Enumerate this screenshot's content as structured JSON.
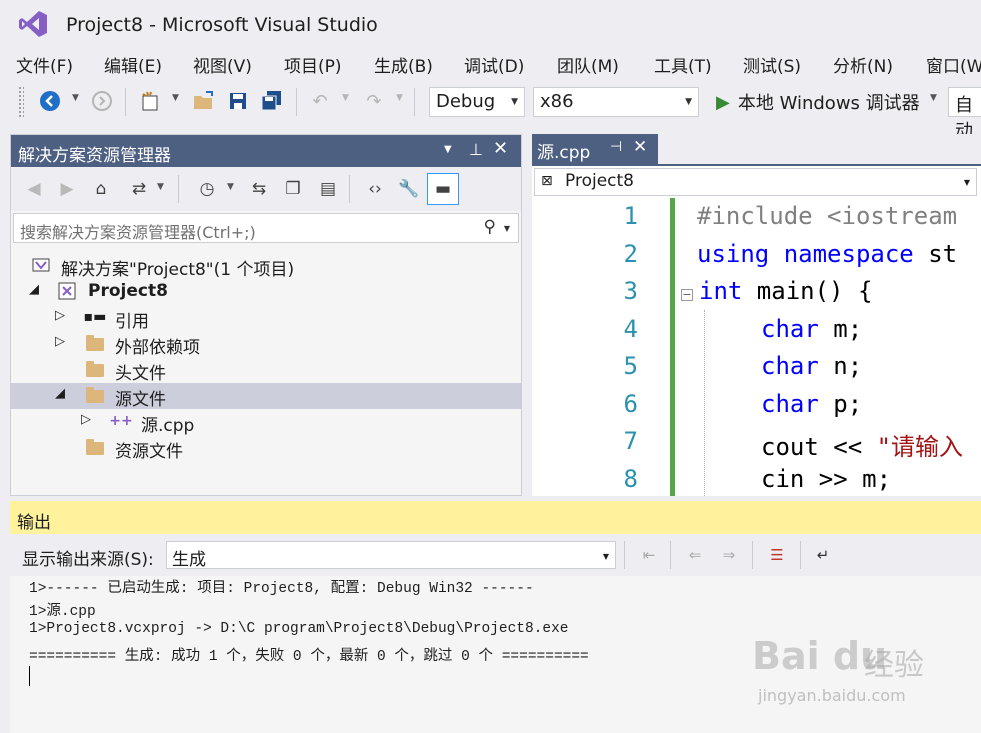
{
  "window": {
    "title": "Project8 - Microsoft Visual Studio"
  },
  "menu": [
    "文件(F)",
    "编辑(E)",
    "视图(V)",
    "项目(P)",
    "生成(B)",
    "调试(D)",
    "团队(M)",
    "工具(T)",
    "测试(S)",
    "分析(N)",
    "窗口(W"
  ],
  "toolbar": {
    "config": "Debug",
    "platform": "x86",
    "run_label": "本地 Windows 调试器",
    "auto_label": "自动"
  },
  "solution_explorer": {
    "title": "解决方案资源管理器",
    "search_placeholder": "搜索解决方案资源管理器(Ctrl+;)",
    "tree": [
      {
        "label": "解决方案\"Project8\"(1 个项目)",
        "bold": false
      },
      {
        "label": "Project8",
        "bold": true
      },
      {
        "label": "引用",
        "bold": false
      },
      {
        "label": "外部依赖项",
        "bold": false
      },
      {
        "label": "头文件",
        "bold": false
      },
      {
        "label": "源文件",
        "bold": false,
        "selected": true
      },
      {
        "label": "源.cpp",
        "bold": false
      },
      {
        "label": "资源文件",
        "bold": false
      }
    ]
  },
  "editor": {
    "tab_label": "源.cpp",
    "nav_project": "Project8",
    "line_numbers": [
      "1",
      "2",
      "3",
      "4",
      "5",
      "6",
      "7",
      "8"
    ],
    "code": {
      "l1_pp": "#include <iostream",
      "l2_kw1": "using",
      "l2_kw2": "namespace",
      "l2_rest": " st",
      "l3_kw": "int",
      "l3_rest": " main() {",
      "l4_kw": "char",
      "l4_rest": " m;",
      "l5_kw": "char",
      "l5_rest": " n;",
      "l6_kw": "char",
      "l6_rest": " p;",
      "l7_code": "cout << ",
      "l7_str": "\"请输入",
      "l8_code": "cin >> m;"
    }
  },
  "output": {
    "title": "输出",
    "source_label": "显示输出来源(S):",
    "source_value": "生成",
    "lines": [
      "1>------ 已启动生成: 项目: Project8, 配置: Debug Win32 ------",
      "1>源.cpp",
      "1>Project8.vcxproj -> D:\\C program\\Project8\\Debug\\Project8.exe",
      "========== 生成: 成功 1 个，失败 0 个，最新 0 个，跳过 0 个 =========="
    ]
  },
  "watermark": {
    "brand": "Bai du",
    "cn": "经验",
    "url": "jingyan.baidu.com"
  },
  "colors": {
    "accent": "#4d6082",
    "output_header": "#fff29d",
    "keyword": "#0000ff",
    "line_number": "#2b91af",
    "change_bar": "#57a64a",
    "vs_purple": "#865fc5"
  }
}
